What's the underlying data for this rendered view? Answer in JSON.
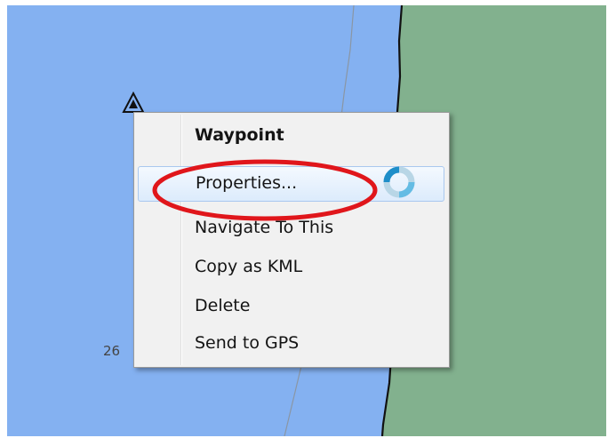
{
  "map": {
    "depth_label": "26",
    "colors": {
      "water": "#84b1f1",
      "land": "#82b18e",
      "shoreline": "#111111"
    },
    "icons": {
      "waypoint": "waypoint-triangle-icon",
      "cursor": "busy-cursor-icon"
    }
  },
  "context_menu": {
    "title": "Waypoint",
    "items": [
      {
        "label": "Properties...",
        "highlighted": true
      },
      {
        "label": "Navigate To This"
      },
      {
        "label": "Copy as KML"
      },
      {
        "label": "Delete"
      },
      {
        "label": "Send to GPS"
      }
    ],
    "annotation_color": "#e0161b"
  }
}
